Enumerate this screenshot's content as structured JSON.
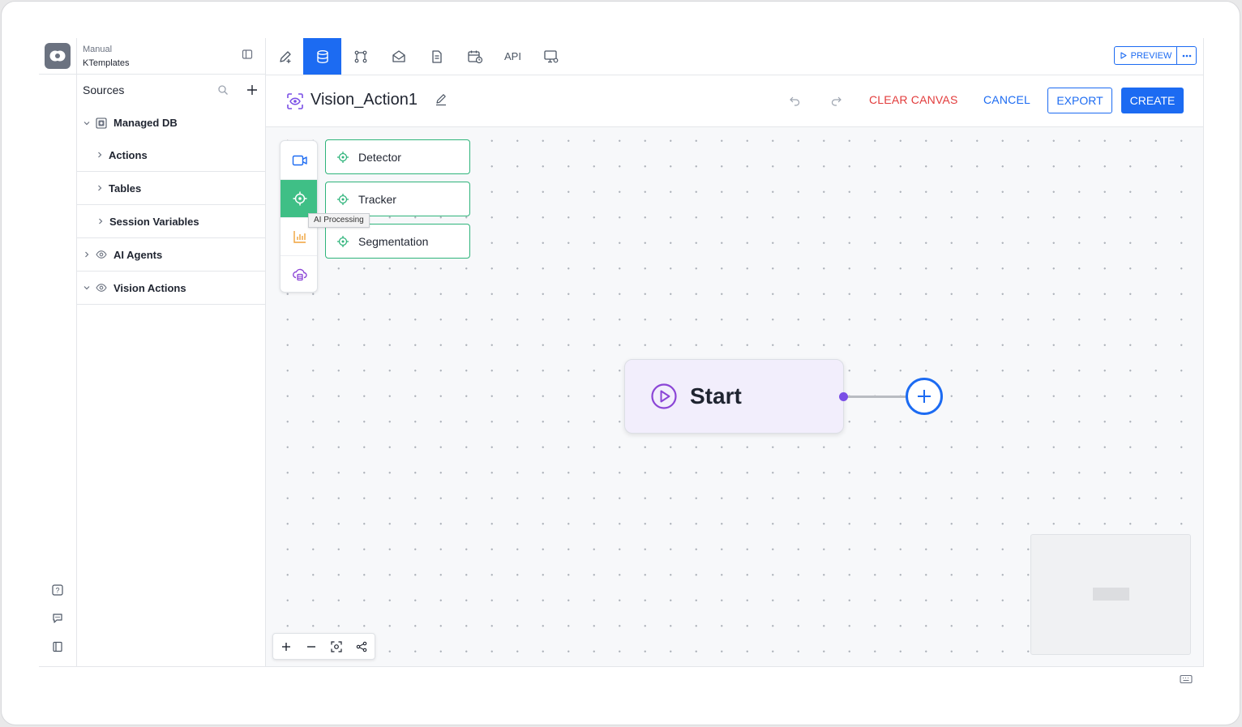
{
  "workspace": {
    "label": "Manual",
    "name": "KTemplates"
  },
  "sidebar": {
    "title": "Sources",
    "tree": [
      {
        "label": "Managed DB",
        "expanded": true
      },
      {
        "label": "Actions"
      },
      {
        "label": "Tables"
      },
      {
        "label": "Session Variables"
      },
      {
        "label": "AI Agents",
        "expanded": false
      },
      {
        "label": "Vision Actions",
        "expanded": true
      }
    ]
  },
  "toolbar": {
    "api_label": "API",
    "preview_label": "PREVIEW",
    "active_tab": "database"
  },
  "flow": {
    "name": "Vision_Action1",
    "clear_label": "CLEAR CANVAS",
    "cancel_label": "CANCEL",
    "export_label": "EXPORT",
    "create_label": "CREATE"
  },
  "palette": {
    "active_category": "ai-processing",
    "tooltip": "AI Processing",
    "nodes": [
      "Detector",
      "Tracker",
      "Segmentation"
    ]
  },
  "canvas": {
    "start_label": "Start"
  },
  "colors": {
    "accent": "#1c6bf2",
    "success": "#3fbf86",
    "danger": "#e23b3b",
    "start_bg": "#f2eefc",
    "port": "#7a4fe6"
  }
}
